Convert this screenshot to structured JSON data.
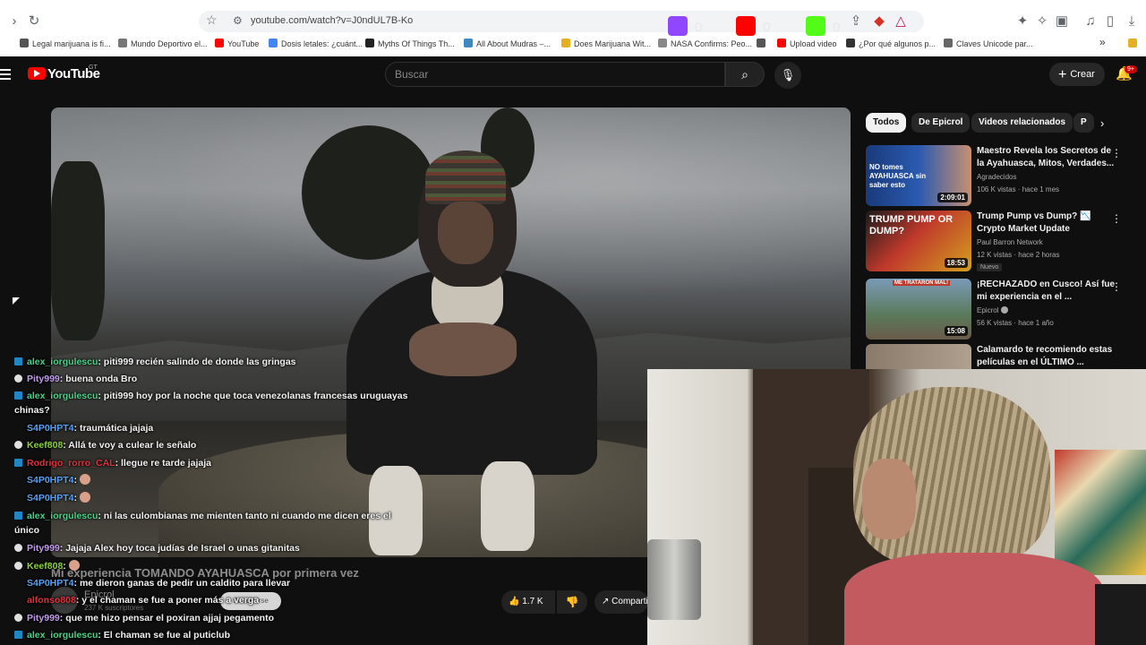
{
  "browser": {
    "url": "youtube.com/watch?v=J0ndUL7B-Ko",
    "extension_counts": [
      "0",
      "0",
      "0"
    ],
    "bookmarks": [
      "Legal marijuana is fi...",
      "Mundo Deportivo el...",
      "YouTube",
      "Dosis letales: ¿cuánt...",
      "Myths Of Things Th...",
      "All About Mudras –...",
      "Does Marijuana Wit...",
      "NASA Confirms: Peo...",
      "Upload video",
      "¿Por qué algunos p...",
      "Claves Unicode par..."
    ]
  },
  "youtube": {
    "logo_text": "YouTube",
    "country_code": "GT",
    "search_placeholder": "Buscar",
    "create_label": "Crear",
    "notification_badge": "9+"
  },
  "video": {
    "title": "Mi experiencia TOMANDO AYAHUASCA por primera vez",
    "channel": "Epicrol",
    "subscribers": "237 K suscriptores",
    "subscribe_label": "Suscribirse",
    "likes": "1.7 K",
    "share_label": "Compartir"
  },
  "chips": [
    "Todos",
    "De Epicrol",
    "Videos relacionados",
    "P"
  ],
  "recommendations": [
    {
      "title": "Maestro Revela los Secretos de la Ayahuasca, Mitos, Verdades...",
      "channel": "Agradecidos",
      "meta": "106 K vistas · hace 1 mes",
      "duration": "2:09:01",
      "thumb_text": "NO tomes AYAHUASCA sin saber esto"
    },
    {
      "title": "Trump Pump vs Dump? 📉 Crypto Market Update",
      "channel": "Paul Barron Network",
      "meta": "12 K vistas · hace 2 horas",
      "duration": "18:53",
      "badge": "Nuevo",
      "thumb_text": "TRUMP PUMP OR DUMP?"
    },
    {
      "title": "¡RECHAZADO en Cusco! Así fue mi experiencia en el ...",
      "channel": "Epicrol",
      "meta": "56 K vistas · hace 1 año",
      "duration": "15:08",
      "thumb_text": "ME TRATARON MAL!"
    },
    {
      "title": "Calamardo te recomiendo estas películas en el ÚLTIMO ...",
      "channel": "",
      "meta": "",
      "duration": ""
    }
  ],
  "chat": [
    {
      "icon": "twitch",
      "user": "alex_iorgulescu",
      "color": "#4cd08a",
      "text": ": piti999 recién salindo de donde las gringas"
    },
    {
      "icon": "skull",
      "user": "Pity999",
      "color": "#c59bf0",
      "text": ": buena onda Bro"
    },
    {
      "icon": "twitch",
      "user": "alex_iorgulescu",
      "color": "#4cd08a",
      "text": ": piti999 hoy por la noche que toca venezolanas francesas uruguayas chinas?"
    },
    {
      "icon": "none",
      "user": "S4P0HPT4",
      "color": "#5aa0f0",
      "text": ": traumática jajaja"
    },
    {
      "icon": "skull",
      "user": "Keef808",
      "color": "#8cd03c",
      "text": ": Allá te voy a culear le señalo"
    },
    {
      "icon": "twitch",
      "user": "Rodrigo_rorro_CAL",
      "color": "#e0303c",
      "text": ": llegue re tarde jajaja"
    },
    {
      "icon": "none",
      "user": "S4P0HPT4",
      "color": "#5aa0f0",
      "text": ":",
      "emote": true
    },
    {
      "icon": "none",
      "user": "S4P0HPT4",
      "color": "#5aa0f0",
      "text": ":",
      "emote": true
    },
    {
      "icon": "twitch",
      "user": "alex_iorgulescu",
      "color": "#4cd08a",
      "text": ": ni las culombianas me mienten tanto ni cuando me dicen eres el único"
    },
    {
      "icon": "skull",
      "user": "Pity999",
      "color": "#c59bf0",
      "text": ": Jajaja Alex hoy toca judías de Israel o unas gitanitas"
    },
    {
      "icon": "skull",
      "user": "Keef808",
      "color": "#8cd03c",
      "text": ":",
      "emote": true
    },
    {
      "icon": "none",
      "user": "S4P0HPT4",
      "color": "#5aa0f0",
      "text": ": me dieron ganas de pedir un caldito para llevar"
    },
    {
      "icon": "none",
      "user": "alfonso808",
      "color": "#e0303c",
      "text": ": y el chaman se fue a poner más a verga"
    },
    {
      "icon": "skull",
      "user": "Pity999",
      "color": "#c59bf0",
      "text": ": que me hizo pensar el poxiran ajjaj pegamento"
    },
    {
      "icon": "twitch",
      "user": "alex_iorgulescu",
      "color": "#4cd08a",
      "text": ": El chaman se fue al puticlub"
    }
  ]
}
